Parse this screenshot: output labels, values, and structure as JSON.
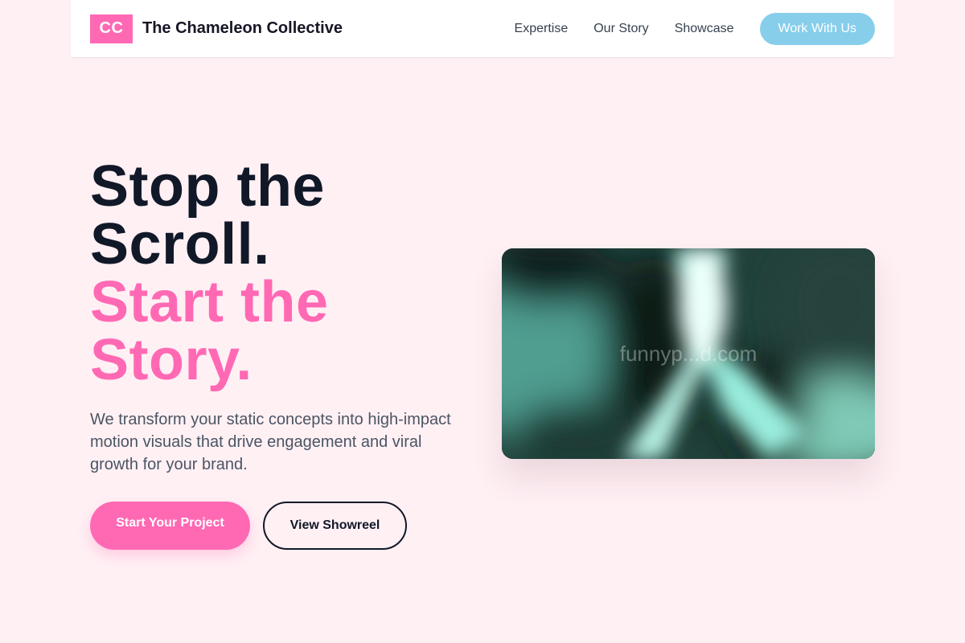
{
  "header": {
    "logo_text": "CC",
    "brand_name": "The Chameleon Collective",
    "nav": [
      {
        "label": "Expertise"
      },
      {
        "label": "Our Story"
      },
      {
        "label": "Showcase"
      }
    ],
    "cta_label": "Work With Us"
  },
  "hero": {
    "title_line1": "Stop the Scroll.",
    "title_line2": "Start the Story.",
    "subtitle": "We transform your static concepts into high-impact motion visuals that drive engagement and viral growth for your brand.",
    "primary_button": "Start Your Project",
    "secondary_button": "View Showreel",
    "media_watermark": "funnyp...d.com"
  },
  "colors": {
    "accent_pink": "#ff69b4",
    "accent_sky": "#87ceeb",
    "background": "#fff0f4",
    "ink": "#111827"
  }
}
